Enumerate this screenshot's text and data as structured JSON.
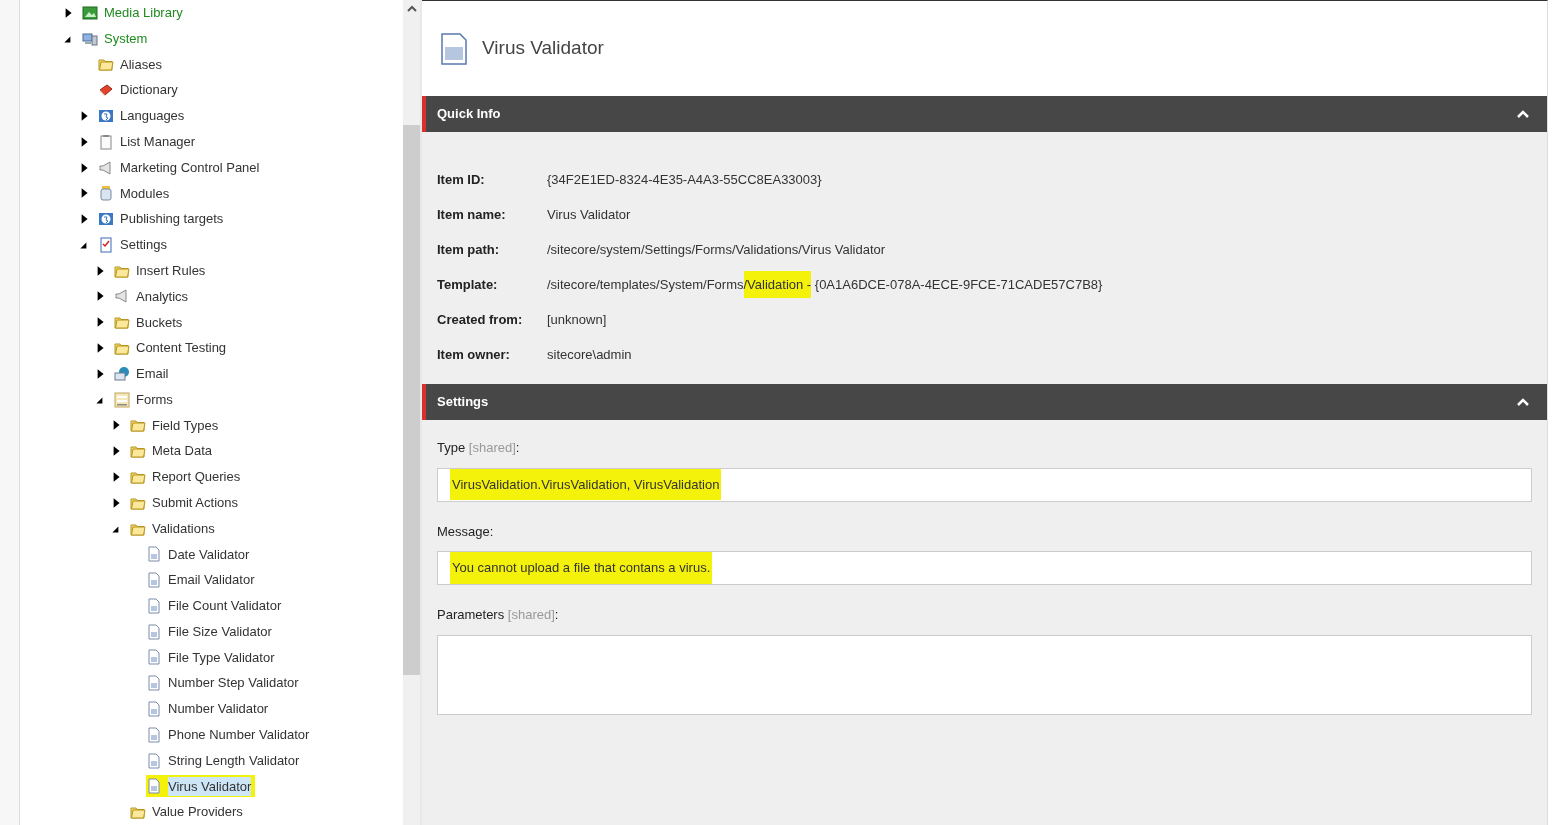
{
  "tree": [
    {
      "label": "Media Library",
      "kind": "media",
      "expanded": false,
      "selected": false,
      "highlighted": false
    },
    {
      "label": "System",
      "kind": "system",
      "expanded": true,
      "selected": false,
      "highlighted": false,
      "children": [
        {
          "label": "Aliases",
          "kind": "folder",
          "selected": false,
          "highlighted": false
        },
        {
          "label": "Dictionary",
          "kind": "book",
          "selected": false,
          "highlighted": false
        },
        {
          "label": "Languages",
          "kind": "globe",
          "expanded": false,
          "selected": false,
          "highlighted": false
        },
        {
          "label": "List Manager",
          "kind": "list",
          "expanded": false,
          "selected": false,
          "highlighted": false
        },
        {
          "label": "Marketing Control Panel",
          "kind": "megaphone",
          "expanded": false,
          "selected": false,
          "highlighted": false
        },
        {
          "label": "Modules",
          "kind": "jar",
          "expanded": false,
          "selected": false,
          "highlighted": false
        },
        {
          "label": "Publishing targets",
          "kind": "globe",
          "expanded": false,
          "selected": false,
          "highlighted": false
        },
        {
          "label": "Settings",
          "kind": "checklist",
          "expanded": true,
          "selected": false,
          "highlighted": false,
          "children": [
            {
              "label": "Insert Rules",
              "kind": "folder",
              "expanded": false,
              "selected": false,
              "highlighted": false
            },
            {
              "label": "Analytics",
              "kind": "megaphone",
              "expanded": false,
              "selected": false,
              "highlighted": false
            },
            {
              "label": "Buckets",
              "kind": "folder",
              "expanded": false,
              "selected": false,
              "highlighted": false
            },
            {
              "label": "Content Testing",
              "kind": "folder",
              "expanded": false,
              "selected": false,
              "highlighted": false
            },
            {
              "label": "Email",
              "kind": "email",
              "expanded": false,
              "selected": false,
              "highlighted": false
            },
            {
              "label": "Forms",
              "kind": "form",
              "expanded": true,
              "selected": false,
              "highlighted": false,
              "children": [
                {
                  "label": "Field Types",
                  "kind": "folder",
                  "expanded": false,
                  "selected": false,
                  "highlighted": false
                },
                {
                  "label": "Meta Data",
                  "kind": "folder",
                  "expanded": false,
                  "selected": false,
                  "highlighted": false
                },
                {
                  "label": "Report Queries",
                  "kind": "folder",
                  "expanded": false,
                  "selected": false,
                  "highlighted": false
                },
                {
                  "label": "Submit Actions",
                  "kind": "folder",
                  "expanded": false,
                  "selected": false,
                  "highlighted": false
                },
                {
                  "label": "Validations",
                  "kind": "folder",
                  "expanded": true,
                  "selected": false,
                  "highlighted": false,
                  "children": [
                    {
                      "label": "Date Validator",
                      "kind": "document",
                      "selected": false,
                      "highlighted": false
                    },
                    {
                      "label": "Email Validator",
                      "kind": "document",
                      "selected": false,
                      "highlighted": false
                    },
                    {
                      "label": "File Count Validator",
                      "kind": "document",
                      "selected": false,
                      "highlighted": false
                    },
                    {
                      "label": "File Size Validator",
                      "kind": "document",
                      "selected": false,
                      "highlighted": false
                    },
                    {
                      "label": "File Type Validator",
                      "kind": "document",
                      "selected": false,
                      "highlighted": false
                    },
                    {
                      "label": "Number Step Validator",
                      "kind": "document",
                      "selected": false,
                      "highlighted": false
                    },
                    {
                      "label": "Number Validator",
                      "kind": "document",
                      "selected": false,
                      "highlighted": false
                    },
                    {
                      "label": "Phone Number Validator",
                      "kind": "document",
                      "selected": false,
                      "highlighted": false
                    },
                    {
                      "label": "String Length Validator",
                      "kind": "document",
                      "selected": false,
                      "highlighted": false
                    },
                    {
                      "label": "Virus Validator",
                      "kind": "document",
                      "selected": true,
                      "highlighted": true
                    }
                  ]
                },
                {
                  "label": "Value Providers",
                  "kind": "folder",
                  "selected": false,
                  "highlighted": false
                }
              ]
            }
          ]
        }
      ]
    }
  ],
  "header": {
    "title": "Virus Validator"
  },
  "sections": [
    {
      "title": "Quick Info",
      "expanded": true,
      "kind": "info",
      "rows": [
        {
          "label": "Item ID:",
          "value": [
            {
              "text": "{34F2E1ED-8324-4E35-A4A3-55CC8EA33003}",
              "highlighted": false
            }
          ]
        },
        {
          "label": "Item name:",
          "value": [
            {
              "text": "Virus Validator",
              "highlighted": false
            }
          ]
        },
        {
          "label": "Item path:",
          "value": [
            {
              "text": "/sitecore/system/Settings/Forms/Validations/Virus Validator",
              "highlighted": false
            }
          ]
        },
        {
          "label": "Template:",
          "value": [
            {
              "text": "/sitecore/templates/System/Forms",
              "highlighted": false
            },
            {
              "text": "/Validation -",
              "highlighted": true
            },
            {
              "text": " {0A1A6DCE-078A-4ECE-9FCE-71CADE57C7B8}",
              "highlighted": false
            }
          ]
        },
        {
          "label": "Created from:",
          "value": [
            {
              "text": "[unknown]",
              "highlighted": false
            }
          ]
        },
        {
          "label": "Item owner:",
          "value": [
            {
              "text": "sitecore\\admin",
              "highlighted": false
            }
          ]
        }
      ]
    },
    {
      "title": "Settings",
      "expanded": true,
      "kind": "fields",
      "fields": [
        {
          "label": "Type",
          "note": "[shared]",
          "suffix": ":",
          "value": "VirusValidation.VirusValidation, VirusValidation",
          "kind": "line",
          "highlighted": true
        },
        {
          "label": "Message:",
          "value": "You cannot upload a file that contans a virus.",
          "kind": "line",
          "highlighted": true
        },
        {
          "label": "Parameters",
          "note": "[shared]",
          "suffix": ":",
          "kind": "area"
        }
      ]
    }
  ]
}
